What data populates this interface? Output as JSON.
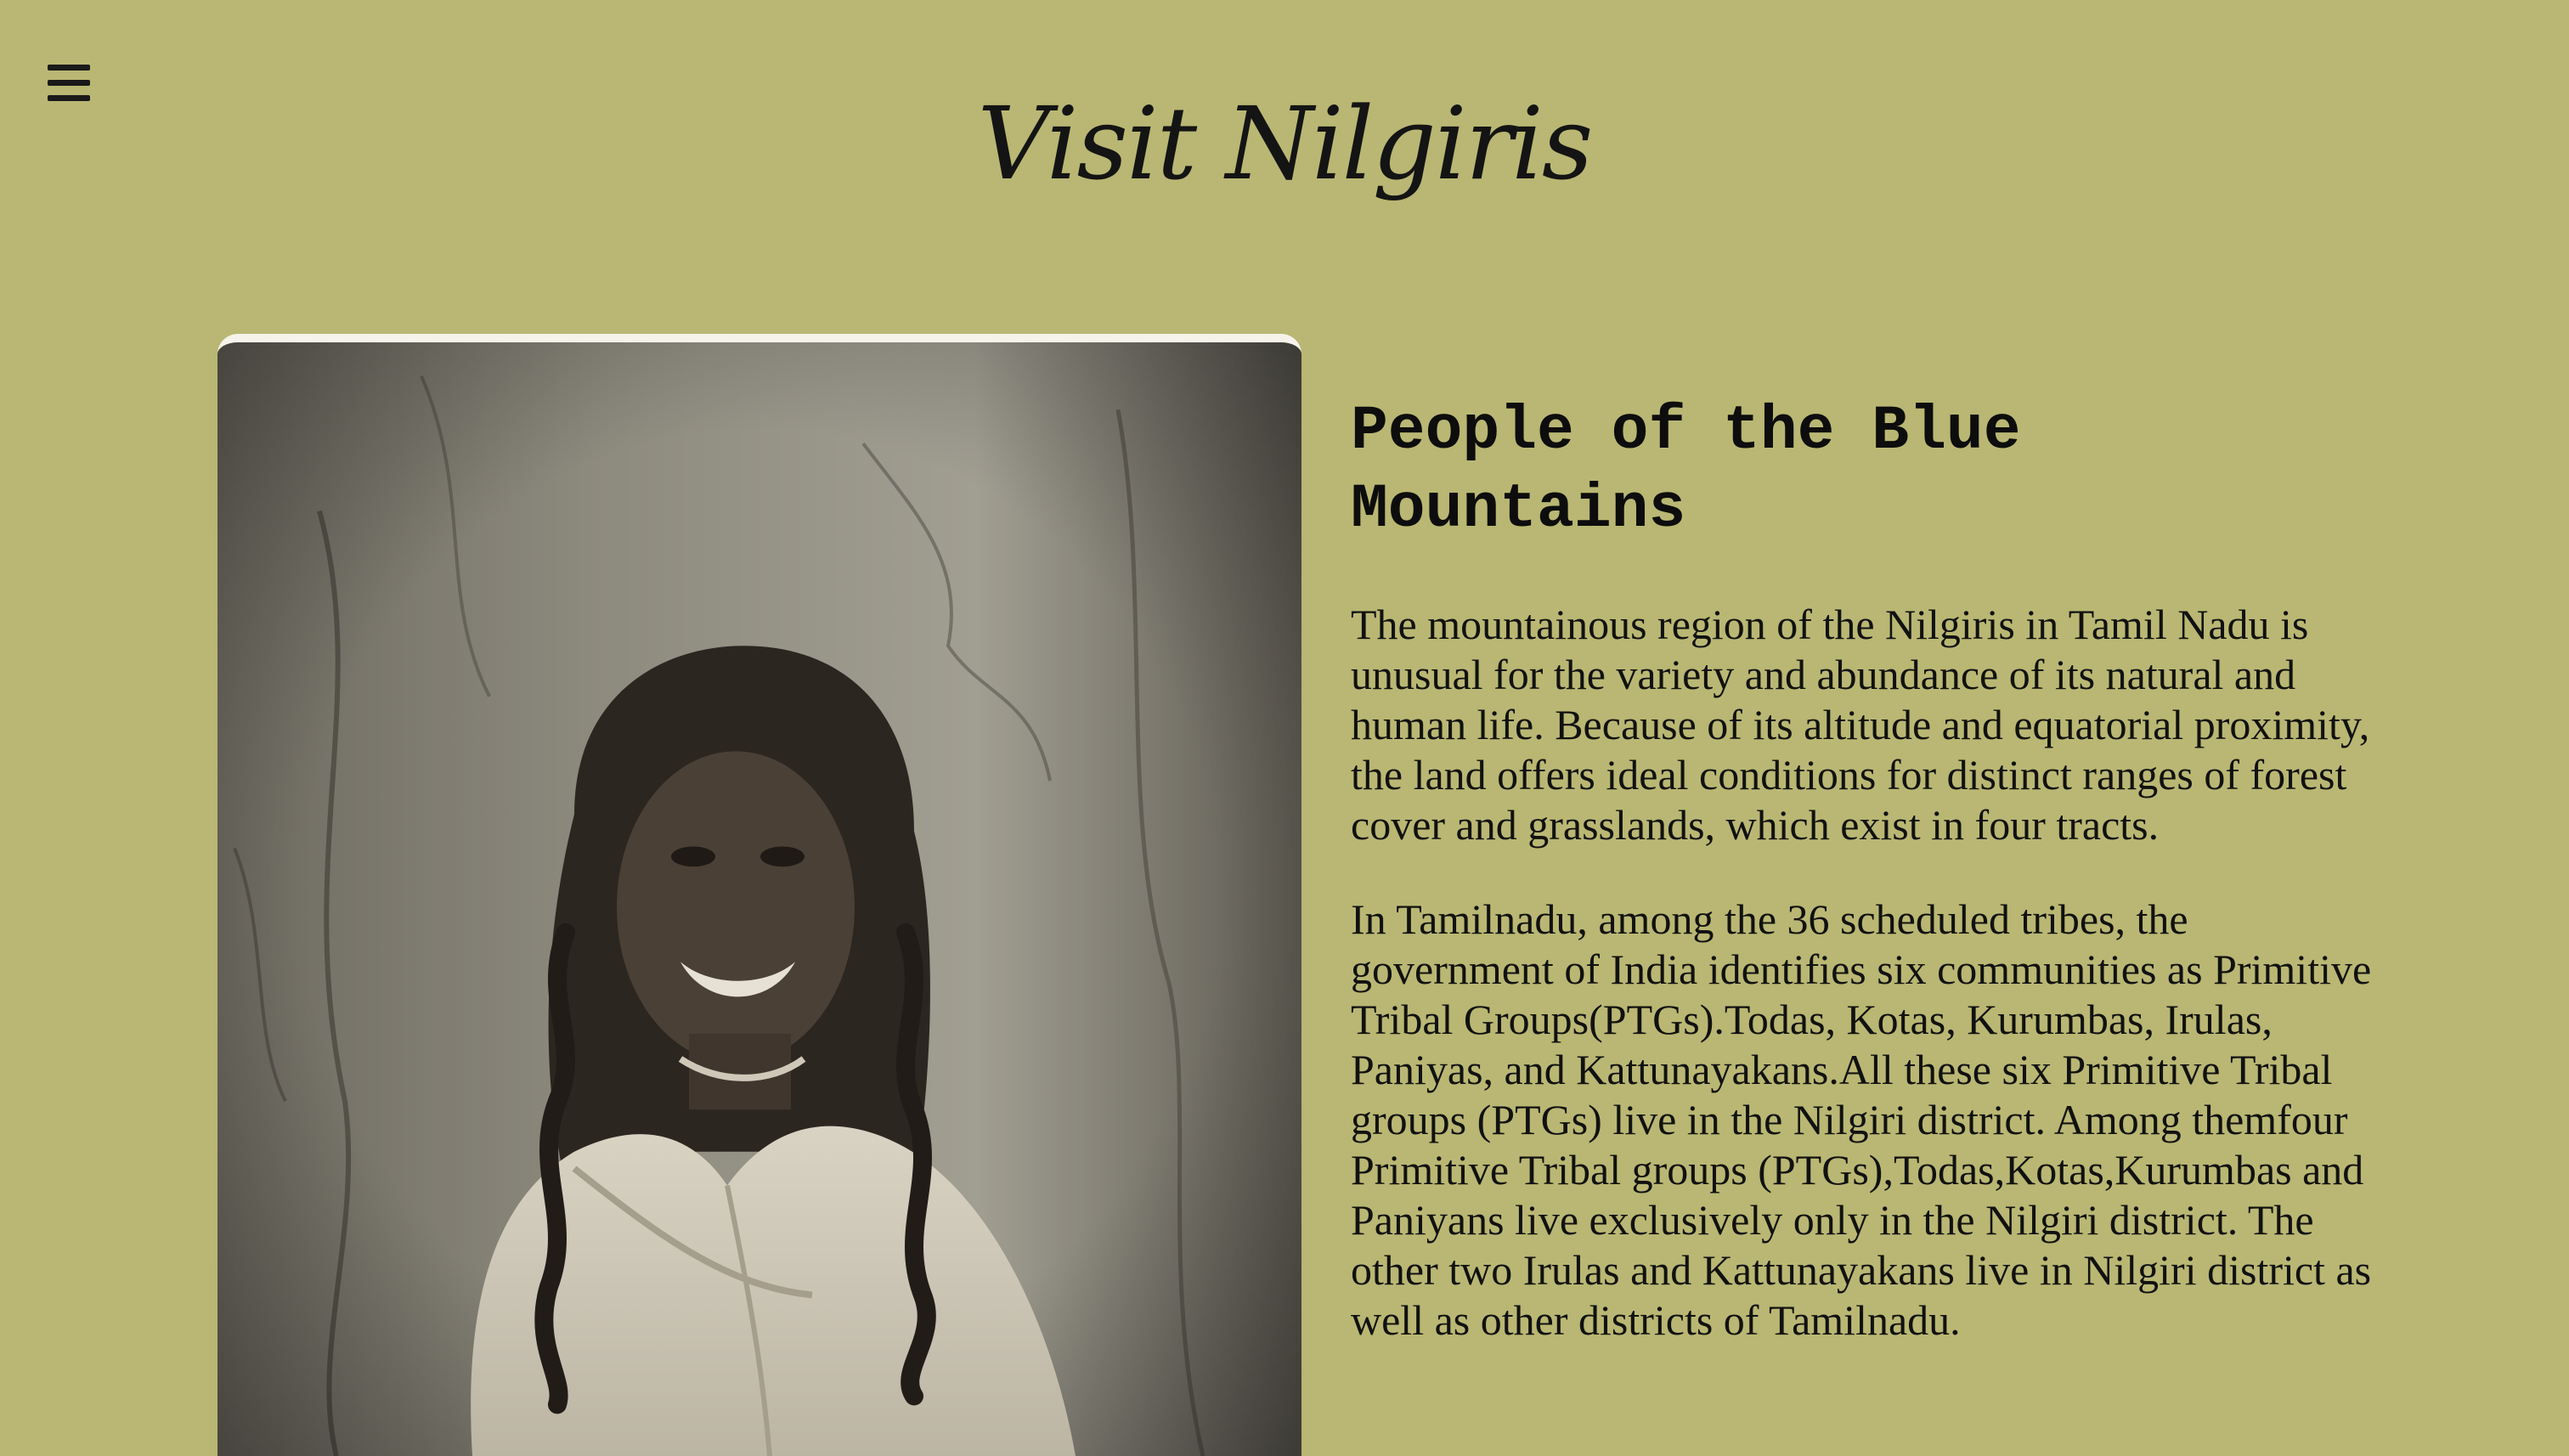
{
  "menu": {
    "icon": "hamburger-menu-icon"
  },
  "site": {
    "title": "Visit Nilgiris"
  },
  "photo": {
    "alt": "Portrait photograph"
  },
  "article": {
    "heading": "People of the Blue Mountains",
    "paragraphs": [
      "The mountainous region of the Nilgiris in Tamil Nadu is unusual for the variety and abundance of its natural and human life. Because of its altitude and equatorial proximity, the land offers ideal conditions for distinct ranges of forest cover and grasslands, which exist in four tracts.",
      "In Tamilnadu, among the 36 scheduled tribes, the government of India identifies six communities as Primitive Tribal Groups(PTGs).Todas, Kotas, Kurumbas, Irulas, Paniyas, and Kattunayakans.All these six Primitive Tribal groups (PTGs) live in the Nilgiri district. Among themfour Primitive Tribal groups (PTGs),Todas,Kotas,Kurumbas and Paniyans live exclusively only in the Nilgiri district. The other two Irulas and Kattunayakans live in Nilgiri district as well as other districts of Tamilnadu."
    ]
  },
  "colors": {
    "background": "#b9b773",
    "text": "#111111"
  }
}
